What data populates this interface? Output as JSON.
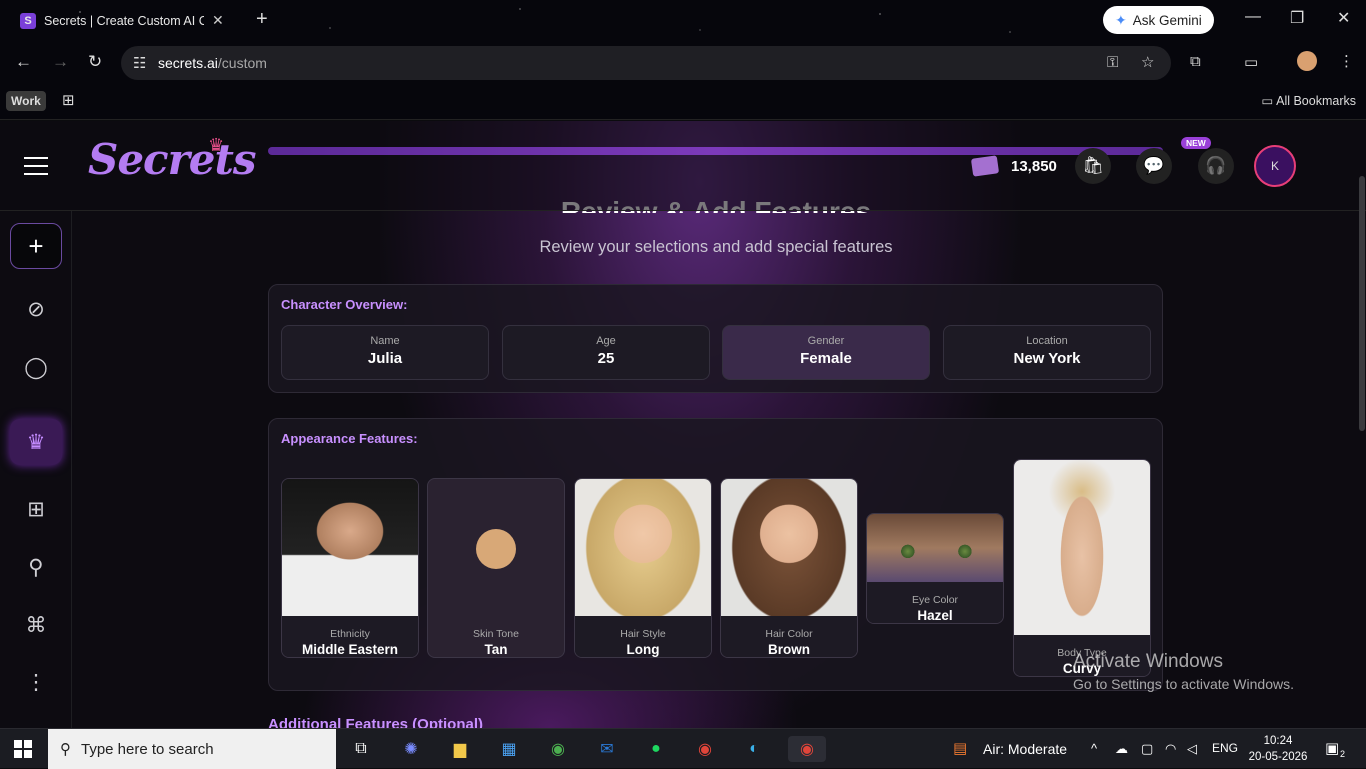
{
  "browser": {
    "tab_title": "Secrets | Create Custom AI Com",
    "url_host": "secrets.ai",
    "url_path": "/custom",
    "ask_gemini": "Ask Gemini",
    "work_label": "Work",
    "all_bookmarks": "All Bookmarks"
  },
  "app": {
    "logo": "Secrets",
    "coins": "13,850",
    "new_badge": "NEW",
    "avatar_initial": "K"
  },
  "page": {
    "heading": "Review & Add Features",
    "subtitle": "Review your selections and add special features",
    "additional_title": "Additional Features (Optional)"
  },
  "overview": {
    "title": "Character Overview:",
    "items": [
      {
        "label": "Name",
        "value": "Julia"
      },
      {
        "label": "Age",
        "value": "25"
      },
      {
        "label": "Gender",
        "value": "Female"
      },
      {
        "label": "Location",
        "value": "New York"
      }
    ]
  },
  "appearance": {
    "title": "Appearance Features:",
    "items": [
      {
        "label": "Ethnicity",
        "value": "Middle Eastern"
      },
      {
        "label": "Skin Tone",
        "value": "Tan"
      },
      {
        "label": "Hair Style",
        "value": "Long"
      },
      {
        "label": "Hair Color",
        "value": "Brown"
      },
      {
        "label": "Eye Color",
        "value": "Hazel"
      },
      {
        "label": "Body Type",
        "value": "Curvy"
      }
    ]
  },
  "watermark": {
    "line1": "Activate Windows",
    "line2": "Go to Settings to activate Windows."
  },
  "taskbar": {
    "search_placeholder": "Type here to search",
    "air": "Air: Moderate",
    "lang": "ENG",
    "time": "10:24",
    "date": "20-05-2026",
    "notifications": "2"
  },
  "colors": {
    "accent": "#c890ff",
    "avatar_ring": "#e83e78",
    "skin_tone": "#d8a877"
  }
}
